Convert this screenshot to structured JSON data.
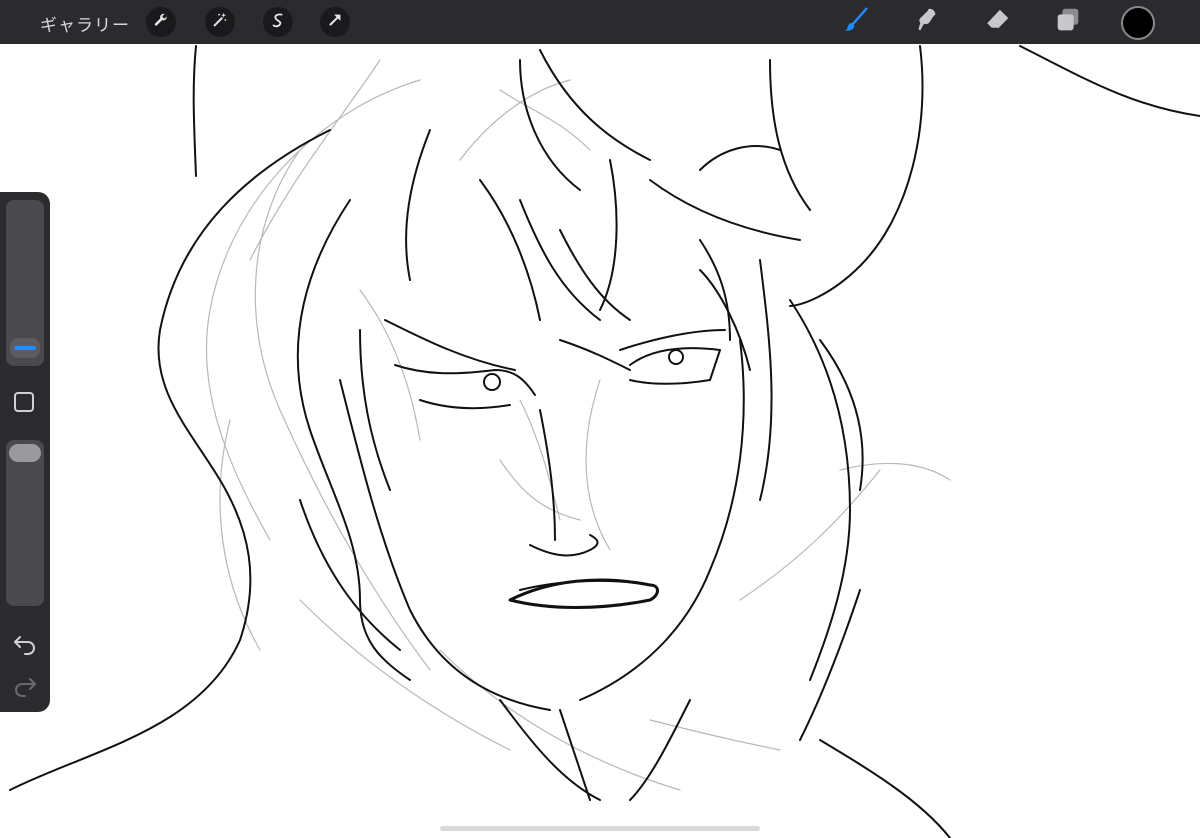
{
  "toolbar": {
    "gallery_label": "ギャラリー",
    "left_tools": [
      "wrench-icon",
      "magic-wand-icon",
      "selection-icon",
      "transform-arrow-icon"
    ],
    "right_tools": [
      "brush-icon",
      "smudge-icon",
      "eraser-icon",
      "layers-icon"
    ],
    "active_tool": "brush-icon",
    "active_color": "#1f8cff",
    "current_color": "#000000"
  },
  "sidebar": {
    "brush_size_level": 0.85,
    "opacity_level": 0.0,
    "accent": "#1f8cff"
  },
  "canvas": {
    "background": "#ffffff",
    "content": "sketch-of-face"
  }
}
